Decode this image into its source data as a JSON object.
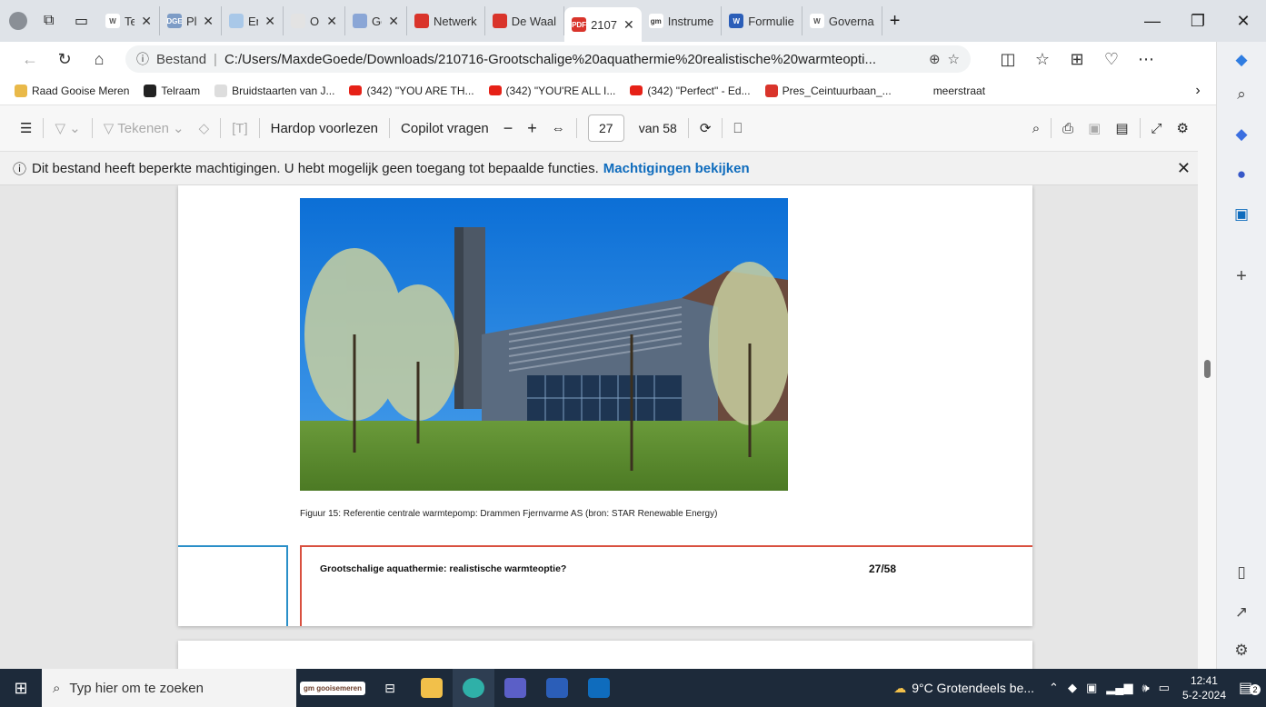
{
  "browser": {
    "tabs": [
      {
        "label": "Terr",
        "fav_color": "#ffffff",
        "fav_text": "W",
        "fav_fg": "#555"
      },
      {
        "label": "Plan",
        "fav_color": "#7d9cc6",
        "fav_text": "DGE",
        "fav_fg": "#fff"
      },
      {
        "label": "Ener",
        "fav_color": "#a9c8e8",
        "fav_text": "",
        "fav_fg": "#fff"
      },
      {
        "label": "Ont",
        "fav_color": "#e3e3e3",
        "fav_text": "",
        "fav_fg": "#fff"
      },
      {
        "label": "Gen",
        "fav_color": "#8aa6d6",
        "fav_text": "",
        "fav_fg": "#fff"
      },
      {
        "label": "Netwerk",
        "fav_color": "#d9342b",
        "fav_text": "",
        "fav_fg": "#fff"
      },
      {
        "label": "De Waal",
        "fav_color": "#d9342b",
        "fav_text": "",
        "fav_fg": "#fff"
      },
      {
        "label": "2107",
        "fav_color": "#d9342b",
        "fav_text": "PDF",
        "fav_fg": "#fff",
        "active": true
      },
      {
        "label": "Instrume",
        "fav_color": "#ffffff",
        "fav_text": "gm",
        "fav_fg": "#333"
      },
      {
        "label": "Formulie",
        "fav_color": "#2b5eb8",
        "fav_text": "W",
        "fav_fg": "#fff"
      },
      {
        "label": "Governa",
        "fav_color": "#ffffff",
        "fav_text": "W",
        "fav_fg": "#555"
      }
    ],
    "address": {
      "prefix": "Bestand",
      "url": "C:/Users/MaxdeGoede/Downloads/210716-Grootschalige%20aquathermie%20realistische%20warmteopti..."
    },
    "favorites": [
      {
        "label": "Raad Gooise Meren",
        "icon": "folder-icon"
      },
      {
        "label": "Telraam",
        "icon": "telraam-icon"
      },
      {
        "label": "Bruidstaarten van J...",
        "icon": "m-icon"
      },
      {
        "label": "(342) \"YOU ARE TH...",
        "icon": "youtube-icon"
      },
      {
        "label": "(342) \"YOU'RE ALL I...",
        "icon": "youtube-icon"
      },
      {
        "label": "(342) \"Perfect\" - Ed...",
        "icon": "youtube-icon"
      },
      {
        "label": "Pres_Ceintuurbaan_...",
        "icon": "pdf-icon"
      },
      {
        "label": "meerstraat",
        "icon": ""
      }
    ]
  },
  "pdf_toolbar": {
    "draw_label": "Tekenen",
    "read_aloud": "Hardop voorlezen",
    "copilot": "Copilot vragen",
    "page_number": "27",
    "page_total": "van 58"
  },
  "infobar": {
    "message": "Dit bestand heeft beperkte machtigingen. U hebt mogelijk geen toegang tot bepaalde functies.",
    "link": "Machtigingen bekijken"
  },
  "document": {
    "caption": "Figuur 15: Referentie centrale warmtepomp: Drammen Fjernvarme AS (bron: STAR Renewable Energy)",
    "footer_title": "Grootschalige aquathermie: realistische warmteoptie?",
    "footer_page": "27/58"
  },
  "taskbar": {
    "search_placeholder": "Typ hier om te zoeken",
    "gm_label": "gm gooisemeren",
    "weather": "9°C  Grotendeels be...",
    "time": "12:41",
    "date": "5-2-2024",
    "notifications": "2"
  }
}
